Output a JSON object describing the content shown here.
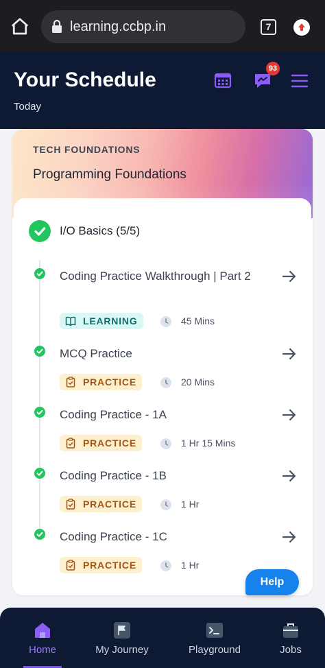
{
  "browser": {
    "url": "learning.ccbp.in",
    "tab_count": "7",
    "icons": [
      "home-icon",
      "lock-icon",
      "tab-switcher-icon",
      "upload-icon"
    ]
  },
  "header": {
    "title": "Your Schedule",
    "subtitle": "Today",
    "notification_count": "93",
    "icons": [
      "calendar-icon",
      "chat-icon",
      "hamburger-menu-icon"
    ],
    "accent_color": "#8b5cf6"
  },
  "course": {
    "category": "TECH FOUNDATIONS",
    "title": "Programming Foundations",
    "section": {
      "title": "I/O Basics (5/5)",
      "lessons": [
        {
          "title": "Coding Practice Walkthrough | Part 2",
          "tag": "LEARNING",
          "tag_icon": "book-icon",
          "duration": "45 Mins",
          "completed": true
        },
        {
          "title": "MCQ Practice",
          "tag": "PRACTICE",
          "tag_icon": "clipboard-icon",
          "duration": "20 Mins",
          "completed": true
        },
        {
          "title": "Coding Practice - 1A",
          "tag": "PRACTICE",
          "tag_icon": "clipboard-icon",
          "duration": "1 Hr 15 Mins",
          "completed": true
        },
        {
          "title": "Coding Practice - 1B",
          "tag": "PRACTICE",
          "tag_icon": "clipboard-icon",
          "duration": "1 Hr",
          "completed": true
        },
        {
          "title": "Coding Practice - 1C",
          "tag": "PRACTICE",
          "tag_icon": "clipboard-icon",
          "duration": "1 Hr",
          "completed": true
        }
      ]
    }
  },
  "help_button": {
    "label": "Help"
  },
  "bottom_nav": {
    "items": [
      {
        "label": "Home",
        "icon": "home-icon",
        "active": true
      },
      {
        "label": "My Journey",
        "icon": "flag-icon",
        "active": false
      },
      {
        "label": "Playground",
        "icon": "terminal-icon",
        "active": false
      },
      {
        "label": "Jobs",
        "icon": "briefcase-icon",
        "active": false
      }
    ]
  },
  "colors": {
    "header_bg": "#0e1a33",
    "success": "#22c55e",
    "learning_tag_bg": "#d9f7f4",
    "practice_tag_bg": "#fdf0cf",
    "help_button": "#1683ed"
  }
}
